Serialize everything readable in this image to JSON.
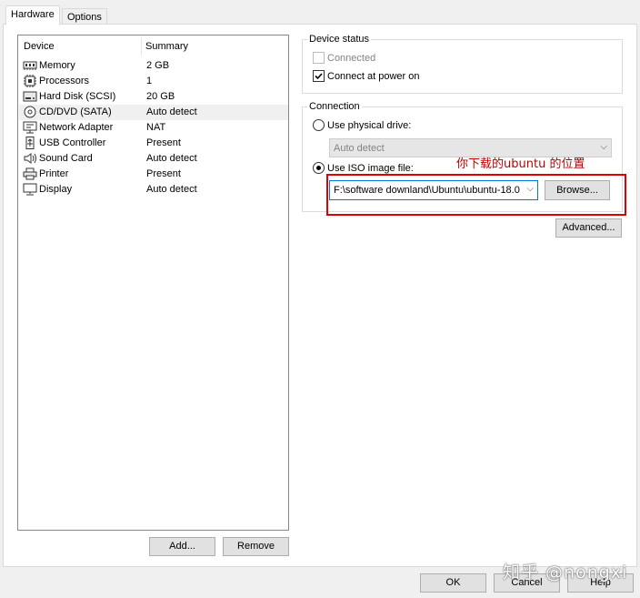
{
  "tabs": [
    {
      "label": "Hardware",
      "active": true
    },
    {
      "label": "Options",
      "active": false
    }
  ],
  "device_list": {
    "header": {
      "device": "Device",
      "summary": "Summary"
    },
    "rows": [
      {
        "name": "Memory",
        "summary": "2 GB",
        "icon": "memory-icon"
      },
      {
        "name": "Processors",
        "summary": "1",
        "icon": "processor-icon"
      },
      {
        "name": "Hard Disk (SCSI)",
        "summary": "20 GB",
        "icon": "hard-disk-icon"
      },
      {
        "name": "CD/DVD (SATA)",
        "summary": "Auto detect",
        "icon": "cd-dvd-icon",
        "selected": true
      },
      {
        "name": "Network Adapter",
        "summary": "NAT",
        "icon": "network-adapter-icon"
      },
      {
        "name": "USB Controller",
        "summary": "Present",
        "icon": "usb-icon"
      },
      {
        "name": "Sound Card",
        "summary": "Auto detect",
        "icon": "speaker-icon"
      },
      {
        "name": "Printer",
        "summary": "Present",
        "icon": "printer-icon"
      },
      {
        "name": "Display",
        "summary": "Auto detect",
        "icon": "monitor-icon"
      }
    ]
  },
  "list_buttons": {
    "add": "Add...",
    "remove": "Remove"
  },
  "device_status": {
    "title": "Device status",
    "connected": {
      "label": "Connected",
      "checked": false,
      "disabled": true
    },
    "connect_at_power_on": {
      "label": "Connect at power on",
      "checked": true
    }
  },
  "connection": {
    "title": "Connection",
    "physical": {
      "label": "Use physical drive:",
      "selected": false
    },
    "physical_value": "Auto detect",
    "iso": {
      "label": "Use ISO image file:",
      "selected": true
    },
    "iso_value": "F:\\software downland\\Ubuntu\\ubuntu-18.0",
    "browse": "Browse..."
  },
  "advanced": "Advanced...",
  "annotation": "你下载的ubuntu 的位置",
  "watermark": "知乎 @nongxi",
  "footer": {
    "ok": "OK",
    "cancel": "Cancel",
    "help": "Help"
  },
  "colors": {
    "annotation": "#c00000",
    "selection": "#f0f0f0",
    "focus": "#0078d7"
  }
}
